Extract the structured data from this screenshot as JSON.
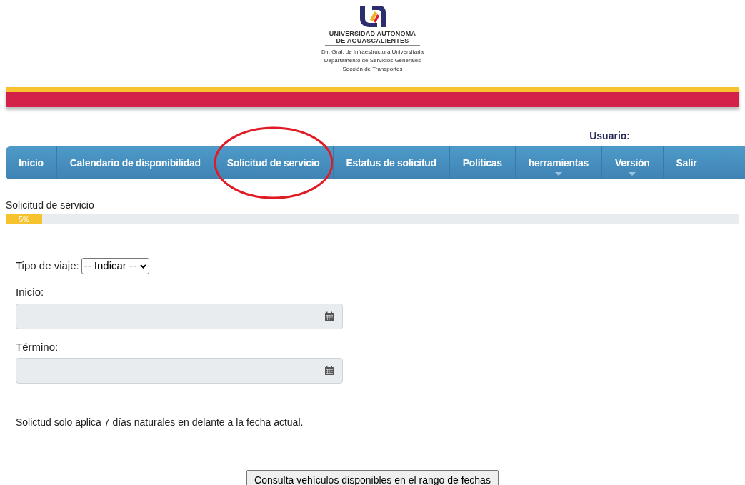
{
  "header": {
    "university": [
      "UNIVERSIDAD AUTONOMA",
      "DE AGUASCALIENTES"
    ],
    "departments": [
      "Dir. Gral. de Infraestructura Universitaria",
      "Departamento de Servicios Generales",
      "Sección de Transportes"
    ]
  },
  "user": {
    "label": "Usuario:"
  },
  "nav": [
    {
      "label": "Inicio",
      "dropdown": false,
      "circled": false
    },
    {
      "label": "Calendario de disponibilidad",
      "dropdown": false,
      "circled": false
    },
    {
      "label": "Solicitud de servicio",
      "dropdown": false,
      "circled": true
    },
    {
      "label": "Estatus de solicitud",
      "dropdown": false,
      "circled": false
    },
    {
      "label": "Políticas",
      "dropdown": false,
      "circled": false
    },
    {
      "label": "herramientas",
      "dropdown": true,
      "circled": false
    },
    {
      "label": "Versión",
      "dropdown": true,
      "circled": false
    },
    {
      "label": "Salir",
      "dropdown": false,
      "circled": false
    }
  ],
  "progress": {
    "title": "Solicitud de servicio",
    "level": 0.05,
    "reading": "5%"
  },
  "form": {
    "trip_type": {
      "label": "Tipo de viaje:",
      "value": "-- Indicar --"
    },
    "start": {
      "label": "Inicio:"
    },
    "end": {
      "label": "Término:"
    },
    "note": "Solictud solo aplica 7 días naturales en delante a la fecha actual.",
    "submit": "Consulta vehículos disponibles en el rango de fechas"
  }
}
